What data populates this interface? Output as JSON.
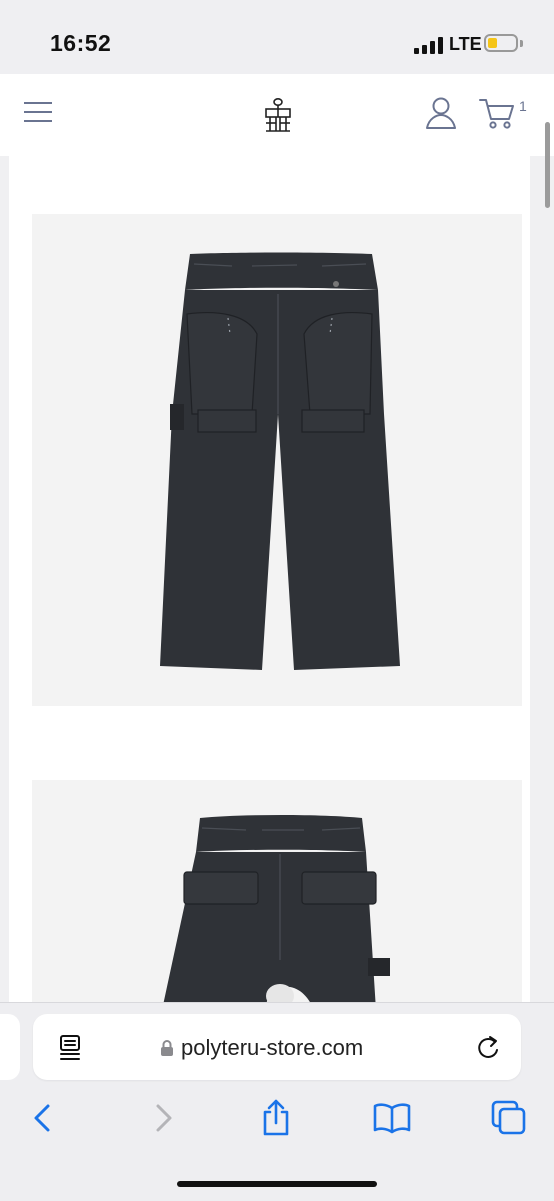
{
  "status_bar": {
    "time": "16:52",
    "network": "LTE",
    "battery_level": 0.35,
    "signal_bars": 4
  },
  "header": {
    "menu_icon": "hamburger-menu-icon",
    "logo_icon": "polyteru-logo-icon",
    "account_icon": "user-icon",
    "cart_icon": "shopping-cart-icon",
    "cart_count": "1"
  },
  "products": {
    "images": [
      {
        "subject": "black-cargo-pants-front"
      },
      {
        "subject": "black-cargo-pants-back"
      }
    ]
  },
  "browser": {
    "url": "polyteru-store.com",
    "reader_icon": "reader-mode-icon",
    "lock_icon": "lock-icon",
    "reload_icon": "reload-icon",
    "toolbar": [
      "back-icon",
      "forward-icon",
      "share-icon",
      "bookmarks-icon",
      "tabs-icon"
    ]
  },
  "colors": {
    "accent": "#6a7491",
    "pants": "#2f3237",
    "link_blue": "#1a73e8"
  }
}
